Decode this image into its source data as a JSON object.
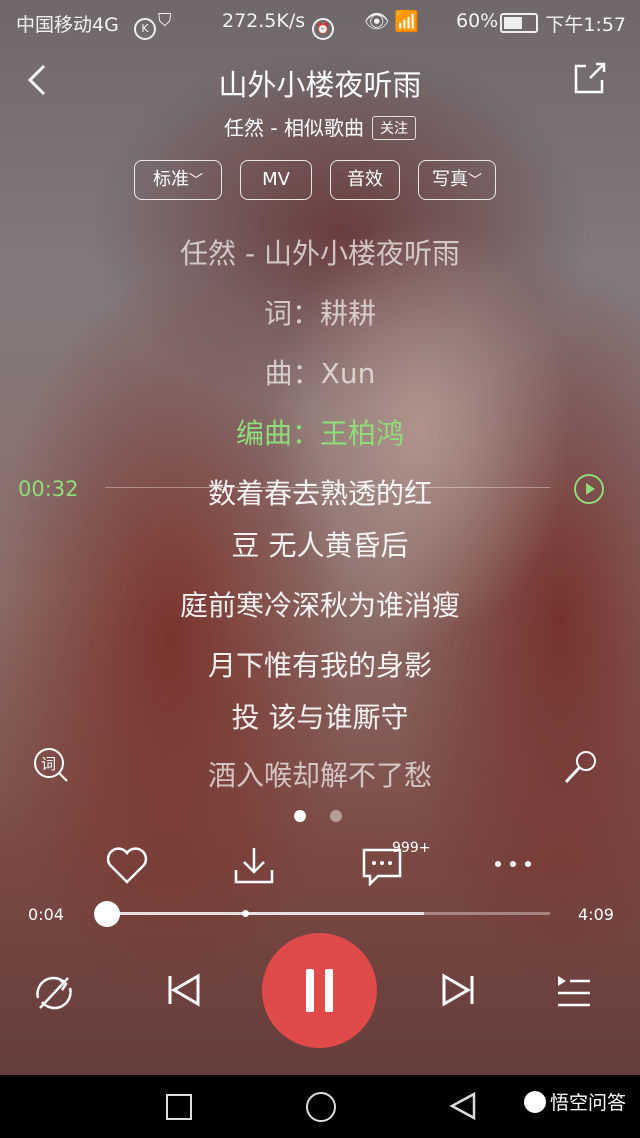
{
  "status_bar": {
    "carrier": "中国移动4G",
    "speed": "272.5K/s",
    "battery": "60%",
    "time": "下午1:57"
  },
  "header": {
    "title": "山外小楼夜听雨",
    "subtitle": "任然 - 相似歌曲",
    "follow_label": "关注"
  },
  "options": {
    "quality": "标准",
    "mv": "MV",
    "effects": "音效",
    "photo": "写真"
  },
  "lyrics": {
    "lines": [
      "任然 - 山外小楼夜听雨",
      "词：耕耕",
      "曲：Xun",
      "编曲：王柏鸿",
      "数着春去熟透的红",
      "豆 无人黄昏后",
      "庭前寒冷深秋为谁消瘦",
      "月下惟有我的身影",
      "投 该与谁厮守",
      "酒入喉却解不了愁"
    ],
    "seek_time": "00:32"
  },
  "actions": {
    "comment_count": "999+"
  },
  "progress": {
    "current": "0:04",
    "total": "4:09",
    "played_fraction": 0.016,
    "buffered_fraction": 0.72
  },
  "watermark": "悟空问答",
  "colors": {
    "accent_green": "#8fdc7a",
    "play_red": "#e04a4a"
  }
}
